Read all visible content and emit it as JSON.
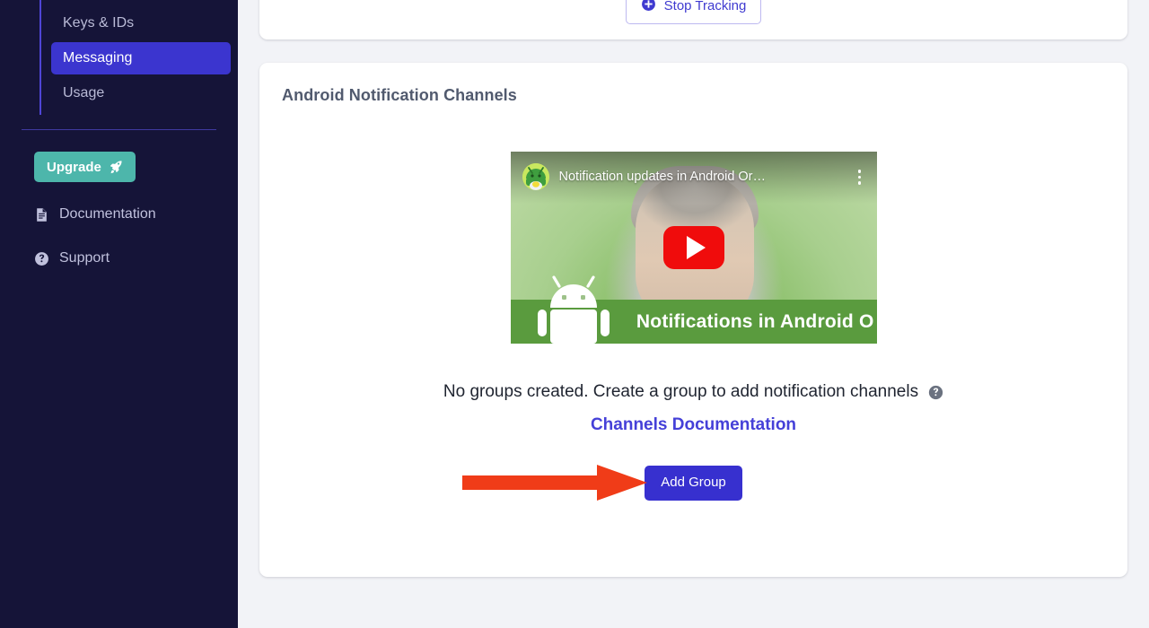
{
  "sidebar": {
    "nav_items": [
      {
        "label": "Keys & IDs",
        "active": false,
        "name": "sidebar-item-keys-ids"
      },
      {
        "label": "Messaging",
        "active": true,
        "name": "sidebar-item-messaging"
      },
      {
        "label": "Usage",
        "active": false,
        "name": "sidebar-item-usage"
      }
    ],
    "upgrade_label": "Upgrade",
    "upgrade_icon": "rocket-icon",
    "links": [
      {
        "label": "Documentation",
        "icon": "document-icon"
      },
      {
        "label": "Support",
        "icon": "question-circle-icon"
      }
    ],
    "colors": {
      "background": "#151438",
      "active_item": "#3b35cf",
      "inactive_text": "#b9bad6",
      "rail": "#4f45d6",
      "separator": "#3f39a0",
      "upgrade_bg": "#4db6ab"
    }
  },
  "top_card": {
    "stop_tracking_label": "Stop Tracking",
    "stop_tracking_icon": "plus-circle-icon",
    "accent": "#3f3ad0"
  },
  "channels_card": {
    "title": "Android Notification Channels",
    "video": {
      "title": "Notification updates in Android Or…",
      "caption": "Notifications in Android O",
      "play_icon": "play-button-icon",
      "kebab_icon": "more-vertical-icon",
      "avatar_icon": "channel-avatar-android-icon",
      "brand_color": "#f00c0c"
    },
    "empty_state": {
      "message": "No groups created. Create a group to add notification channels",
      "help_icon": "help-circle-icon",
      "docs_link": "Channels Documentation",
      "docs_link_color": "#4540d8"
    },
    "add_group_label": "Add Group",
    "add_group_color": "#3730cf",
    "annotation": {
      "type": "red-arrow",
      "color": "#f03c18",
      "points_to": "Add Group"
    }
  }
}
